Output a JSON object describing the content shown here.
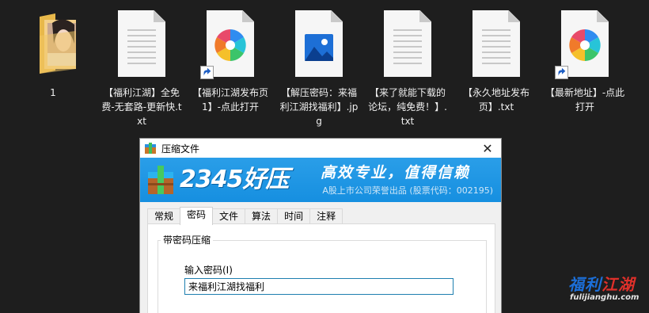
{
  "desktop": {
    "files": [
      {
        "label": "1",
        "type": "folder"
      },
      {
        "label": "【福利江湖】全免费-无套路-更新快.txt",
        "type": "txt"
      },
      {
        "label": "【福利江湖发布页1】-点此打开",
        "type": "shortcut"
      },
      {
        "label": "【解压密码：来福利江湖找福利】.jpg",
        "type": "image"
      },
      {
        "label": "【来了就能下载的论坛，纯免费！】.txt",
        "type": "txt"
      },
      {
        "label": "【永久地址发布页】.txt",
        "type": "txt"
      },
      {
        "label": "【最新地址】-点此打开",
        "type": "shortcut"
      }
    ]
  },
  "dialog": {
    "title": "压缩文件",
    "close_label": "✕",
    "banner": {
      "logo": "2345好压",
      "slogan": "高效专业，值得信赖",
      "subtitle": "A股上市公司荣誉出品 (股票代码：002195)"
    },
    "tabs": [
      {
        "label": "常规",
        "active": false
      },
      {
        "label": "密码",
        "active": true
      },
      {
        "label": "文件",
        "active": false
      },
      {
        "label": "算法",
        "active": false
      },
      {
        "label": "时间",
        "active": false
      },
      {
        "label": "注释",
        "active": false
      }
    ],
    "group_title": "带密码压缩",
    "password_label": "输入密码(I)",
    "password_value": "来福利江湖找福利"
  },
  "watermark": {
    "text": "福利江湖",
    "url": "fulijianghu.com"
  },
  "colors": {
    "background": "#1e1e1e",
    "banner_blue": "#168fe0",
    "input_border": "#1e7fb0",
    "watermark_blue": "#1c6fd8",
    "watermark_red": "#e0302a"
  }
}
